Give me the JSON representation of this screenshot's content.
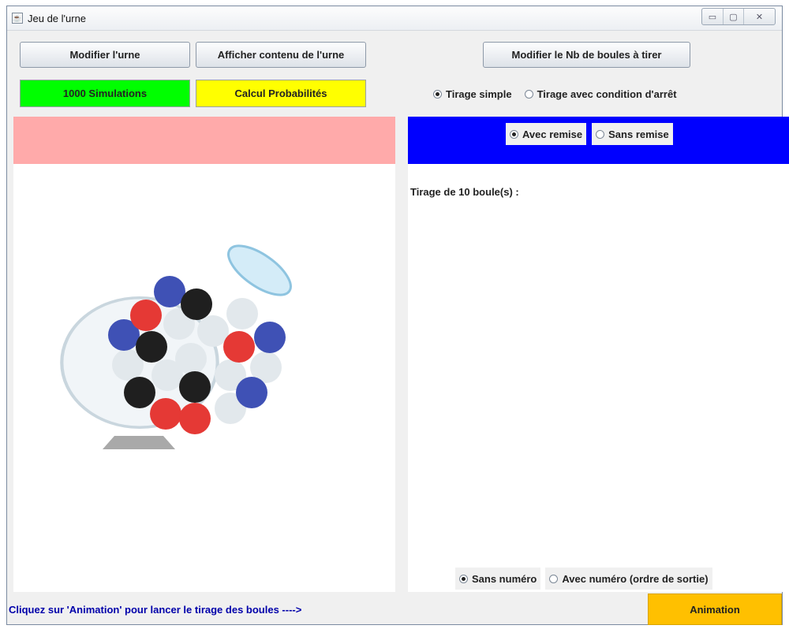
{
  "window": {
    "title": "Jeu de l'urne",
    "controls": {
      "minimize": "▭",
      "maximize": "▢",
      "close": "✕"
    }
  },
  "toolbar": {
    "modifier_urne": "Modifier l'urne",
    "afficher_contenu": "Afficher contenu de l'urne",
    "modifier_nb_boules": "Modifier le Nb de boules à tirer",
    "simulations": "1000 Simulations",
    "calcul_probabilites": "Calcul Probabilités"
  },
  "mode": {
    "tirage_simple": "Tirage simple",
    "tirage_condition": "Tirage avec condition d'arrêt",
    "selected": "tirage_simple"
  },
  "replacement": {
    "avec_remise": "Avec remise",
    "sans_remise": "Sans remise",
    "selected": "avec_remise"
  },
  "results": {
    "heading": "Tirage de 10 boule(s) :"
  },
  "numbering": {
    "sans_numero": "Sans numéro",
    "avec_numero": "Avec numéro (ordre de sortie)",
    "selected": "sans_numero"
  },
  "status": {
    "message": "Cliquez sur 'Animation' pour lancer le tirage des boules ---->",
    "animation_button": "Animation"
  },
  "colors": {
    "green": "#00ff00",
    "yellow": "#ffff00",
    "pink": "#ffaaaa",
    "blue": "#0000ff",
    "orange": "#ffc000",
    "status_text": "#0000aa"
  }
}
